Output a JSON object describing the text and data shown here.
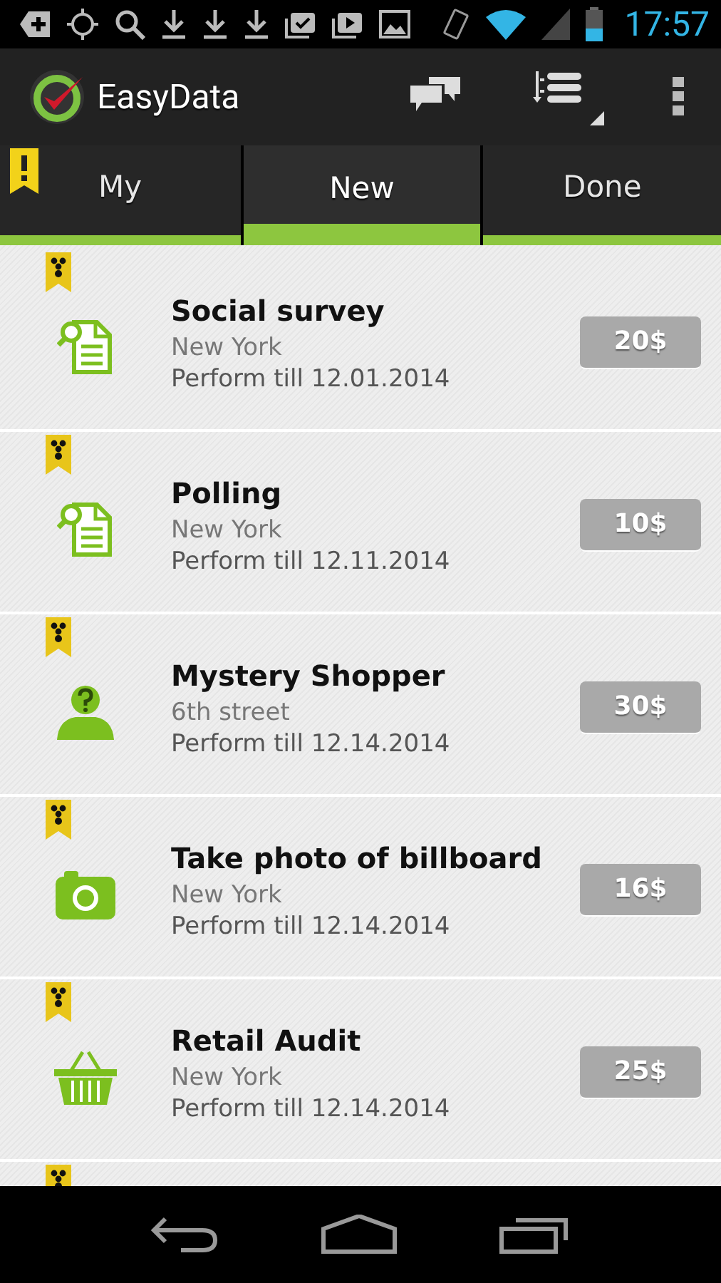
{
  "status_bar": {
    "time": "17:57"
  },
  "app_bar": {
    "title": "EasyData"
  },
  "tabs": [
    {
      "label": "My",
      "selected": false
    },
    {
      "label": "New",
      "selected": true
    },
    {
      "label": "Done",
      "selected": false
    }
  ],
  "tasks": [
    {
      "kind": "survey",
      "title": "Social survey",
      "location": "New York",
      "deadline": "Perform till 12.01.2014",
      "price": "20$"
    },
    {
      "kind": "survey",
      "title": "Polling",
      "location": "New York",
      "deadline": "Perform till 12.11.2014",
      "price": "10$"
    },
    {
      "kind": "person",
      "title": "Mystery Shopper",
      "location": "6th street",
      "deadline": "Perform till 12.14.2014",
      "price": "30$"
    },
    {
      "kind": "camera",
      "title": "Take photo of billboard",
      "location": "New York",
      "deadline": "Perform till 12.14.2014",
      "price": "16$"
    },
    {
      "kind": "basket",
      "title": "Retail Audit",
      "location": "New York",
      "deadline": "Perform till 12.14.2014",
      "price": "25$"
    }
  ]
}
